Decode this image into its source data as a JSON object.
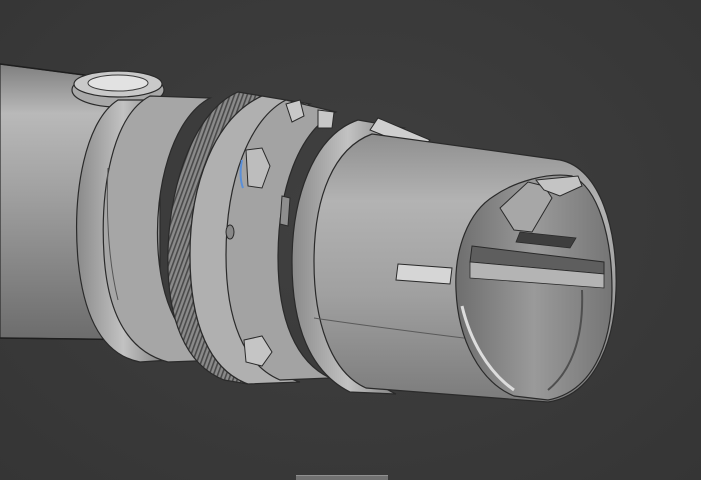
{
  "viewport": {
    "background_color": "#3a3a3a",
    "model_base_color": "#9c9c9c",
    "highlight_color": "#5a8fd8"
  },
  "scene": {
    "icons": {
      "model": "cylindrical-connector-assembly-icon",
      "handle": "viewport-resize-handle-icon"
    }
  }
}
